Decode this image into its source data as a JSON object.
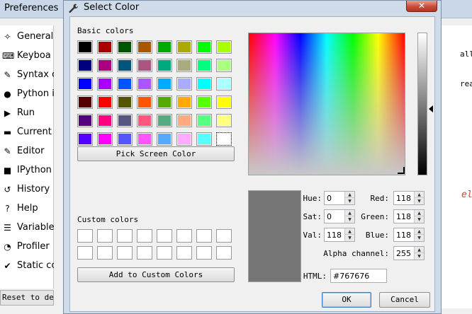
{
  "background_window": {
    "title": "Preferences",
    "sidebar": [
      {
        "label": "General",
        "icon": "wrench-icon",
        "glyph": "✧"
      },
      {
        "label": "Keyboa",
        "icon": "keyboard-icon",
        "glyph": "⌨"
      },
      {
        "label": "Syntax c",
        "icon": "paint-brush-icon",
        "glyph": "✎"
      },
      {
        "label": "Python i",
        "icon": "python-icon",
        "glyph": "●"
      },
      {
        "label": "Run",
        "icon": "play-icon",
        "glyph": "▶"
      },
      {
        "label": "Current",
        "icon": "folder-icon",
        "glyph": "▬"
      },
      {
        "label": "Editor",
        "icon": "edit-icon",
        "glyph": "✎"
      },
      {
        "label": "IPython",
        "icon": "console-icon",
        "glyph": "■"
      },
      {
        "label": "History",
        "icon": "history-icon",
        "glyph": "↺"
      },
      {
        "label": "Help",
        "icon": "help-icon",
        "glyph": "?"
      },
      {
        "label": "Variable",
        "icon": "table-icon",
        "glyph": "☰"
      },
      {
        "label": "Profiler",
        "icon": "profiler-icon",
        "glyph": "◔"
      },
      {
        "label": "Static co",
        "icon": "static-code-icon",
        "glyph": "✔"
      }
    ],
    "reset_button": "Reset to def",
    "right_text": [
      "all",
      "reat",
      "elf"
    ]
  },
  "dialog": {
    "title": "Select Color",
    "close_label": "✕",
    "basic_colors_label": "Basic colors",
    "basic_colors": [
      [
        "#000000",
        "#aa0000",
        "#005500",
        "#aa5500",
        "#00aa00",
        "#aaaa00",
        "#00ff00",
        "#aaff00"
      ],
      [
        "#00007f",
        "#aa007f",
        "#00557f",
        "#aa557f",
        "#00aa7f",
        "#aaaa7f",
        "#00ff7f",
        "#aaff7f"
      ],
      [
        "#0000ff",
        "#aa00ff",
        "#0055ff",
        "#aa55ff",
        "#00aaff",
        "#aaaaff",
        "#00ffff",
        "#aaffff"
      ],
      [
        "#550000",
        "#ff0000",
        "#555500",
        "#ff5500",
        "#55aa00",
        "#ffaa00",
        "#55ff00",
        "#ffff00"
      ],
      [
        "#55007f",
        "#ff007f",
        "#55557f",
        "#ff557f",
        "#55aa7f",
        "#ffaa7f",
        "#55ff7f",
        "#ffff7f"
      ],
      [
        "#5500ff",
        "#ff00ff",
        "#5555ff",
        "#ff55ff",
        "#55aaff",
        "#ffaaff",
        "#55ffff",
        "#ffffff"
      ]
    ],
    "selected_basic": [
      5,
      7
    ],
    "pick_screen_button": "Pick Screen Color",
    "custom_colors_label": "Custom colors",
    "custom_slots": 16,
    "add_custom_button": "Add to Custom Colors",
    "fields": {
      "hue": {
        "label": "Hue:",
        "value": "0"
      },
      "sat": {
        "label": "Sat:",
        "value": "0"
      },
      "val": {
        "label": "Val:",
        "value": "118"
      },
      "red": {
        "label": "Red:",
        "value": "118"
      },
      "green": {
        "label": "Green:",
        "value": "118"
      },
      "blue": {
        "label": "Blue:",
        "value": "118"
      },
      "alpha": {
        "label": "Alpha channel:",
        "value": "255"
      }
    },
    "html_label": "HTML:",
    "html_value": "#767676",
    "current_color": "#767676",
    "ok_button": "OK",
    "cancel_button": "Cancel"
  }
}
